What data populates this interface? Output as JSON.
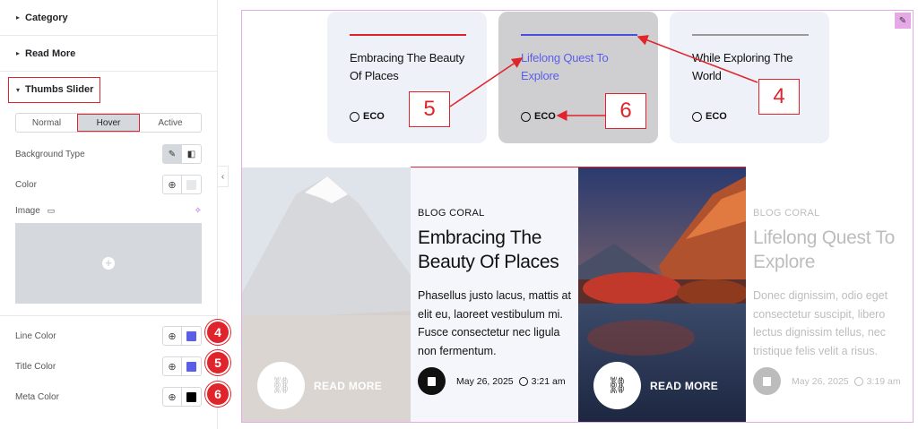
{
  "panel": {
    "sections": [
      {
        "label": "Category"
      },
      {
        "label": "Read More"
      },
      {
        "label": "Thumbs Slider"
      }
    ],
    "state_tabs": [
      "Normal",
      "Hover",
      "Active"
    ],
    "active_tab": "Hover",
    "background_type_label": "Background Type",
    "color_label": "Color",
    "image_label": "Image",
    "line_color_label": "Line Color",
    "title_color_label": "Title Color",
    "meta_color_label": "Meta Color",
    "badges": [
      "4",
      "5",
      "6"
    ],
    "colors": {
      "line": "#5b5fe8",
      "title": "#5b5fe8",
      "meta": "#000000",
      "color_swatch": "#e6e8ea",
      "accent": "#e0242b"
    }
  },
  "thumbs": [
    {
      "title": "Embracing The Beauty Of Places",
      "meta": "ECO",
      "line_color": "#e0242b",
      "title_color": "#111111",
      "bg": "#eef1f7"
    },
    {
      "title": "Lifelong Quest To Explore",
      "meta": "ECO",
      "line_color": "#4a4fe0",
      "title_color": "#5b5fe8",
      "bg": "#cfcfd1"
    },
    {
      "title": "While Exploring The World",
      "meta": "ECO",
      "line_color": "#9a9a9a",
      "title_color": "#111111",
      "bg": "#eef1f7"
    }
  ],
  "callouts": [
    "5",
    "6",
    "4"
  ],
  "slides": [
    {
      "category": "BLOG CORAL",
      "title": "Embracing The Beauty Of Places",
      "excerpt": "Phasellus justo lacus, mattis at elit eu, laoreet vestibulum mi. Fusce consectetur nec ligula non fermentum.",
      "date": "May 26, 2025",
      "time": "3:21 am",
      "read_more": "READ MORE"
    },
    {
      "category": "BLOG CORAL",
      "title": "Lifelong Quest To Explore",
      "excerpt": "Donec dignissim, odio eget consectetur suscipit, libero lectus dignissim tellus, nec tristique felis velit a risus.",
      "date": "May 26, 2025",
      "time": "3:19 am",
      "read_more": "READ MORE"
    }
  ]
}
